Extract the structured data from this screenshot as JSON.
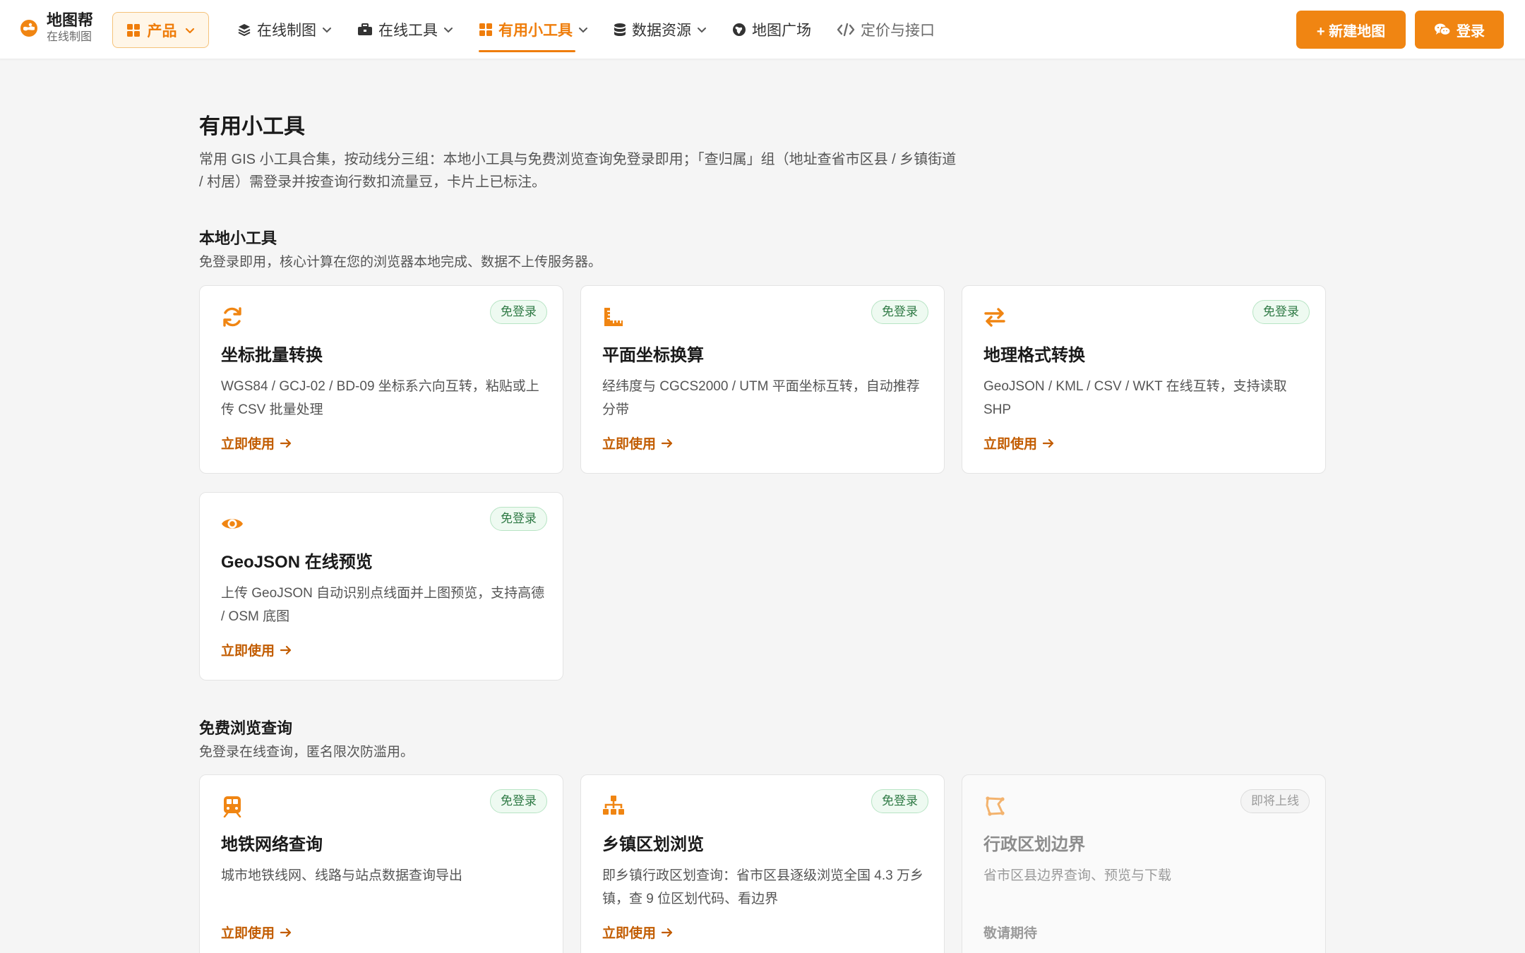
{
  "brand": {
    "name": "地图帮",
    "sub": "在线制图"
  },
  "product_button": {
    "label": "产品",
    "icon": "grid-icon"
  },
  "nav": {
    "items": [
      {
        "label": "在线制图",
        "icon": "layers-icon",
        "has_dropdown": true
      },
      {
        "label": "在线工具",
        "icon": "toolbox-icon",
        "has_dropdown": true
      },
      {
        "label": "有用小工具",
        "icon": "grid-icon",
        "has_dropdown": true,
        "active": true
      },
      {
        "label": "数据资源",
        "icon": "database-icon",
        "has_dropdown": true
      },
      {
        "label": "地图广场",
        "icon": "globe-icon",
        "has_dropdown": false
      },
      {
        "label": "定价与接口",
        "icon": "code-icon",
        "has_dropdown": false
      }
    ]
  },
  "actions": {
    "new_map": "+ 新建地图",
    "login": "登录"
  },
  "page": {
    "title": "有用小工具",
    "desc": "常用 GIS 小工具合集，按动线分三组：本地小工具与免费浏览查询免登录即用；「查归属」组（地址查省市区县 / 乡镇街道 / 村居）需登录并按查询行数扣流量豆，卡片上已标注。"
  },
  "sections": [
    {
      "title": "本地小工具",
      "desc": "免登录即用，核心计算在您的浏览器本地完成、数据不上传服务器。",
      "cards": [
        {
          "icon": "sync-icon",
          "badge": "免登录",
          "title": "坐标批量转换",
          "desc": "WGS84 / GCJ-02 / BD-09 坐标系六向互转，粘贴或上传 CSV 批量处理",
          "link": "立即使用"
        },
        {
          "icon": "ruler-icon",
          "badge": "免登录",
          "title": "平面坐标换算",
          "desc": "经纬度与 CGCS2000 / UTM 平面坐标互转，自动推荐分带",
          "link": "立即使用"
        },
        {
          "icon": "exchange-icon",
          "badge": "免登录",
          "title": "地理格式转换",
          "desc": "GeoJSON / KML / CSV / WKT 在线互转，支持读取 SHP",
          "link": "立即使用"
        },
        {
          "icon": "eye-icon",
          "badge": "免登录",
          "title": "GeoJSON 在线预览",
          "desc": "上传 GeoJSON 自动识别点线面并上图预览，支持高德 / OSM 底图",
          "link": "立即使用"
        }
      ]
    },
    {
      "title": "免费浏览查询",
      "desc": "免登录在线查询，匿名限次防滥用。",
      "cards": [
        {
          "icon": "subway-icon",
          "badge": "免登录",
          "title": "地铁网络查询",
          "desc": "城市地铁线网、线路与站点数据查询导出",
          "link": "立即使用"
        },
        {
          "icon": "sitemap-icon",
          "badge": "免登录",
          "title": "乡镇区划浏览",
          "desc": "即乡镇行政区划查询：省市区县逐级浏览全国 4.3 万乡镇，查 9 位区划代码、看边界",
          "link": "立即使用"
        },
        {
          "icon": "boundary-icon",
          "badge": "即将上线",
          "title": "行政区划边界",
          "desc": "省市区县边界查询、预览与下载",
          "link": "敬请期待"
        }
      ]
    }
  ],
  "colors": {
    "accent": "#f08512",
    "badge_green": "#2f7a45",
    "link": "#c25c00"
  }
}
